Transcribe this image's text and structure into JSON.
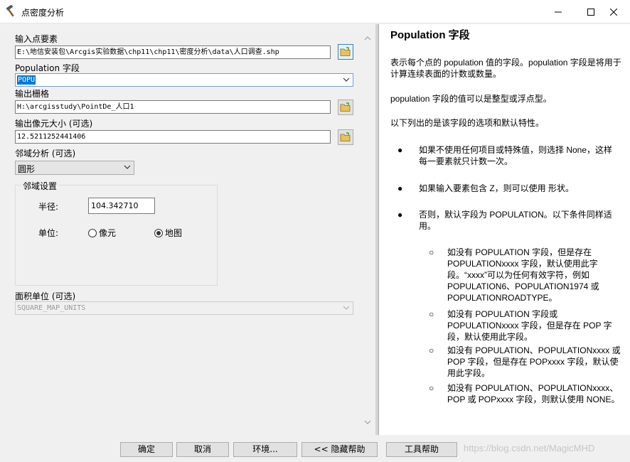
{
  "window": {
    "title": "点密度分析",
    "icon": "hammer-icon"
  },
  "form": {
    "input_points": {
      "label": "输入点要素",
      "value": "E:\\地信安装包\\Arcgis实验数据\\chp11\\chp11\\密度分析\\data\\人口调查.shp"
    },
    "population_field": {
      "label": "Population 字段",
      "value": "POPU"
    },
    "output_raster": {
      "label": "输出栅格",
      "value": "H:\\arcgisstudy\\PointDe_人口1"
    },
    "cell_size": {
      "label": "输出像元大小 (可选)",
      "value": "12.5211252441406"
    },
    "neighborhood": {
      "label": "邻域分析 (可选)",
      "value": "圆形"
    },
    "neighborhood_settings": {
      "title": "邻域设置",
      "radius_label": "半径:",
      "radius_value": "104.342710",
      "units_label": "单位:",
      "unit_cell": "像元",
      "unit_map": "地图",
      "selected_unit": "地图"
    },
    "area_units": {
      "label": "面积单位 (可选)",
      "value": "SQUARE_MAP_UNITS"
    }
  },
  "help": {
    "heading": "Population 字段",
    "p1": "表示每个点的 population 值的字段。population 字段是将用于计算连续表面的计数或数量。",
    "p2": "population 字段的值可以是整型或浮点型。",
    "p3": "以下列出的是该字段的选项和默认特性。",
    "b1": "如果不使用任何项目或特殊值，则选择 None，这样每一要素就只计数一次。",
    "b2": "如果输入要素包含 Z，则可以使用 形状。",
    "b3": "否则，默认字段为 POPULATION。以下条件同样适用。",
    "s1": "如没有 POPULATION 字段，但是存在 POPULATIONxxxx 字段，默认使用此字段。“xxxx”可以为任何有效字符，例如 POPULATION6、POPULATION1974 或 POPULATIONROADTYPE。",
    "s2": "如没有 POPULATION 字段或 POPULATIONxxxx 字段，但是存在 POP 字段，默认使用此字段。",
    "s3": "如没有 POPULATION、POPULATIONxxxx 或 POP 字段，但是存在 POPxxxx 字段，默认使用此字段。",
    "s4": "如没有 POPULATION、POPULATIONxxxx、POP 或 POPxxxx 字段，则默认使用 NONE。"
  },
  "buttons": {
    "ok": "确定",
    "cancel": "取消",
    "environments": "环境...",
    "hide_help": "<< 隐藏帮助",
    "tool_help": "工具帮助"
  },
  "watermark": "https://blog.csdn.net/MagicMHD"
}
